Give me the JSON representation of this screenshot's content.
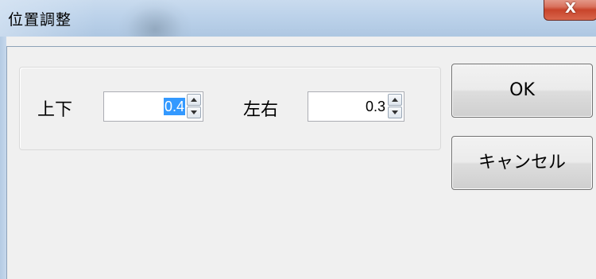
{
  "window": {
    "title": "位置調整",
    "close_glyph": "X"
  },
  "adjust": {
    "vertical": {
      "label": "上下",
      "value": "0.4",
      "selected": true
    },
    "horizontal": {
      "label": "左右",
      "value": "0.3",
      "selected": false
    }
  },
  "buttons": {
    "ok_label": "OK",
    "cancel_label": "キャンセル"
  },
  "colors": {
    "selection": "#3399ff",
    "close_button": "#c8442b",
    "client_background": "#f0f0f0"
  },
  "icons": [
    "close-icon",
    "spin-up-arrow-icon",
    "spin-down-arrow-icon"
  ]
}
